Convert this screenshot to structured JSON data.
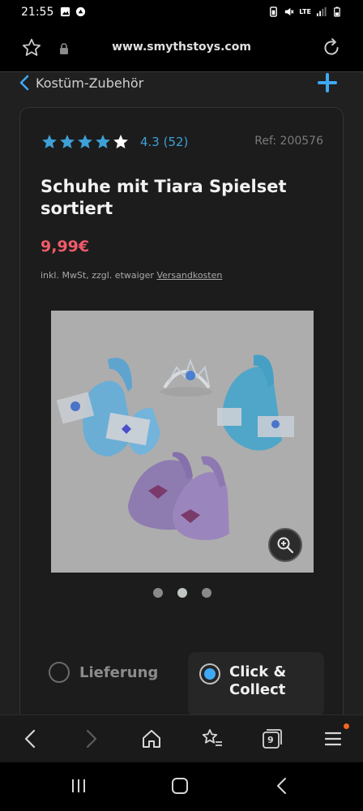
{
  "status_bar": {
    "time": "21:55",
    "network_label": "LTE"
  },
  "browser": {
    "url": "www.smythstoys.com",
    "tab_count": "9"
  },
  "breadcrumb": {
    "label": "Kostüm-Zubehör"
  },
  "product": {
    "rating_value": 4.3,
    "rating_text": "4.3 (52)",
    "stars_max": 5,
    "reference": "Ref: 200576",
    "title": "Schuhe mit Tiara Spielset sortiert",
    "price": "9,99€",
    "tax_note": "inkl. MwSt, zzgl. etwaiger ",
    "shipping_link": "Versandkosten",
    "image_count": 3,
    "active_image_index": 1
  },
  "delivery_options": {
    "option_delivery": "Lieferung",
    "option_collect": "Click & Collect",
    "selected": "Click & Collect"
  },
  "colors": {
    "price": "#f05a6a",
    "rating": "#3ea0d6",
    "accent": "#3fa9f5",
    "notification": "#f26522"
  },
  "icons": {
    "bookmark": "star-outline-icon",
    "lock": "lock-icon",
    "reload": "reload-icon",
    "back": "chevron-left-icon",
    "add": "plus-icon",
    "zoom": "zoom-in-icon",
    "home": "home-icon",
    "bookmarks": "star-list-icon",
    "tabs": "tabs-icon",
    "menu": "menu-icon"
  }
}
